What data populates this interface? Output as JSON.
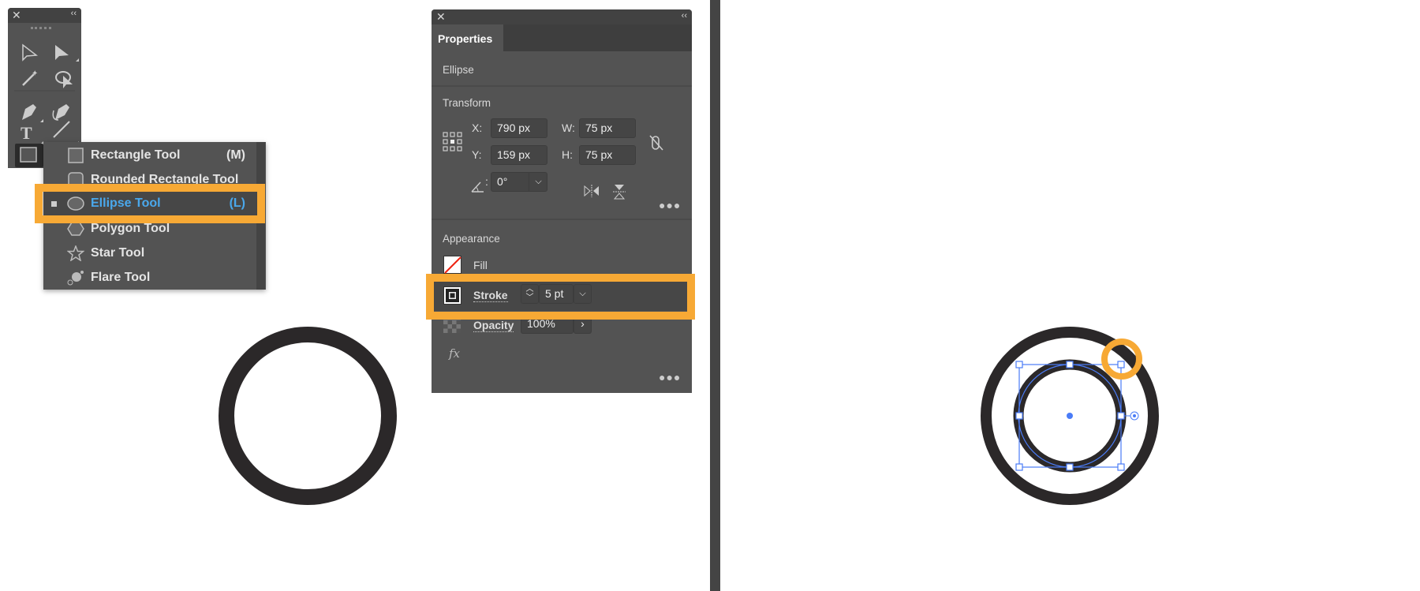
{
  "toolbox": {
    "close_icon": "close-icon",
    "collapse_icon": "double-chevron-left-icon",
    "tools": [
      "selection-tool",
      "direct-selection-tool",
      "magic-wand-tool",
      "lasso-tool",
      "pen-tool",
      "curvature-tool",
      "type-tool",
      "line-segment-tool",
      "rectangle-tool"
    ]
  },
  "shape_menu": {
    "items": [
      {
        "label": "Rectangle Tool",
        "shortcut": "(M)",
        "icon": "rectangle-icon"
      },
      {
        "label": "Rounded Rectangle Tool",
        "shortcut": "",
        "icon": "rounded-rectangle-icon"
      },
      {
        "label": "Ellipse Tool",
        "shortcut": "(L)",
        "icon": "ellipse-icon",
        "selected": true
      },
      {
        "label": "Polygon Tool",
        "shortcut": "",
        "icon": "polygon-icon"
      },
      {
        "label": "Star Tool",
        "shortcut": "",
        "icon": "star-icon"
      },
      {
        "label": "Flare Tool",
        "shortcut": "",
        "icon": "flare-icon"
      }
    ],
    "selected_color": "#4aa8ec"
  },
  "properties": {
    "tab": "Properties",
    "object_type": "Ellipse",
    "transform": {
      "title": "Transform",
      "x_label": "X:",
      "x": "790 px",
      "y_label": "Y:",
      "y": "159 px",
      "w_label": "W:",
      "w": "75 px",
      "h_label": "H:",
      "h": "75 px",
      "angle_label": ":",
      "angle": "0°"
    },
    "appearance": {
      "title": "Appearance",
      "fill_label": "Fill",
      "stroke_label": "Stroke",
      "stroke_value": "5 pt",
      "opacity_label": "Opacity",
      "opacity_value": "100%",
      "fx_label": "fx"
    }
  },
  "colors": {
    "highlight": "#f7a935",
    "panel": "#535353",
    "selection": "#4a7cf7",
    "shape": "#2b2829"
  }
}
